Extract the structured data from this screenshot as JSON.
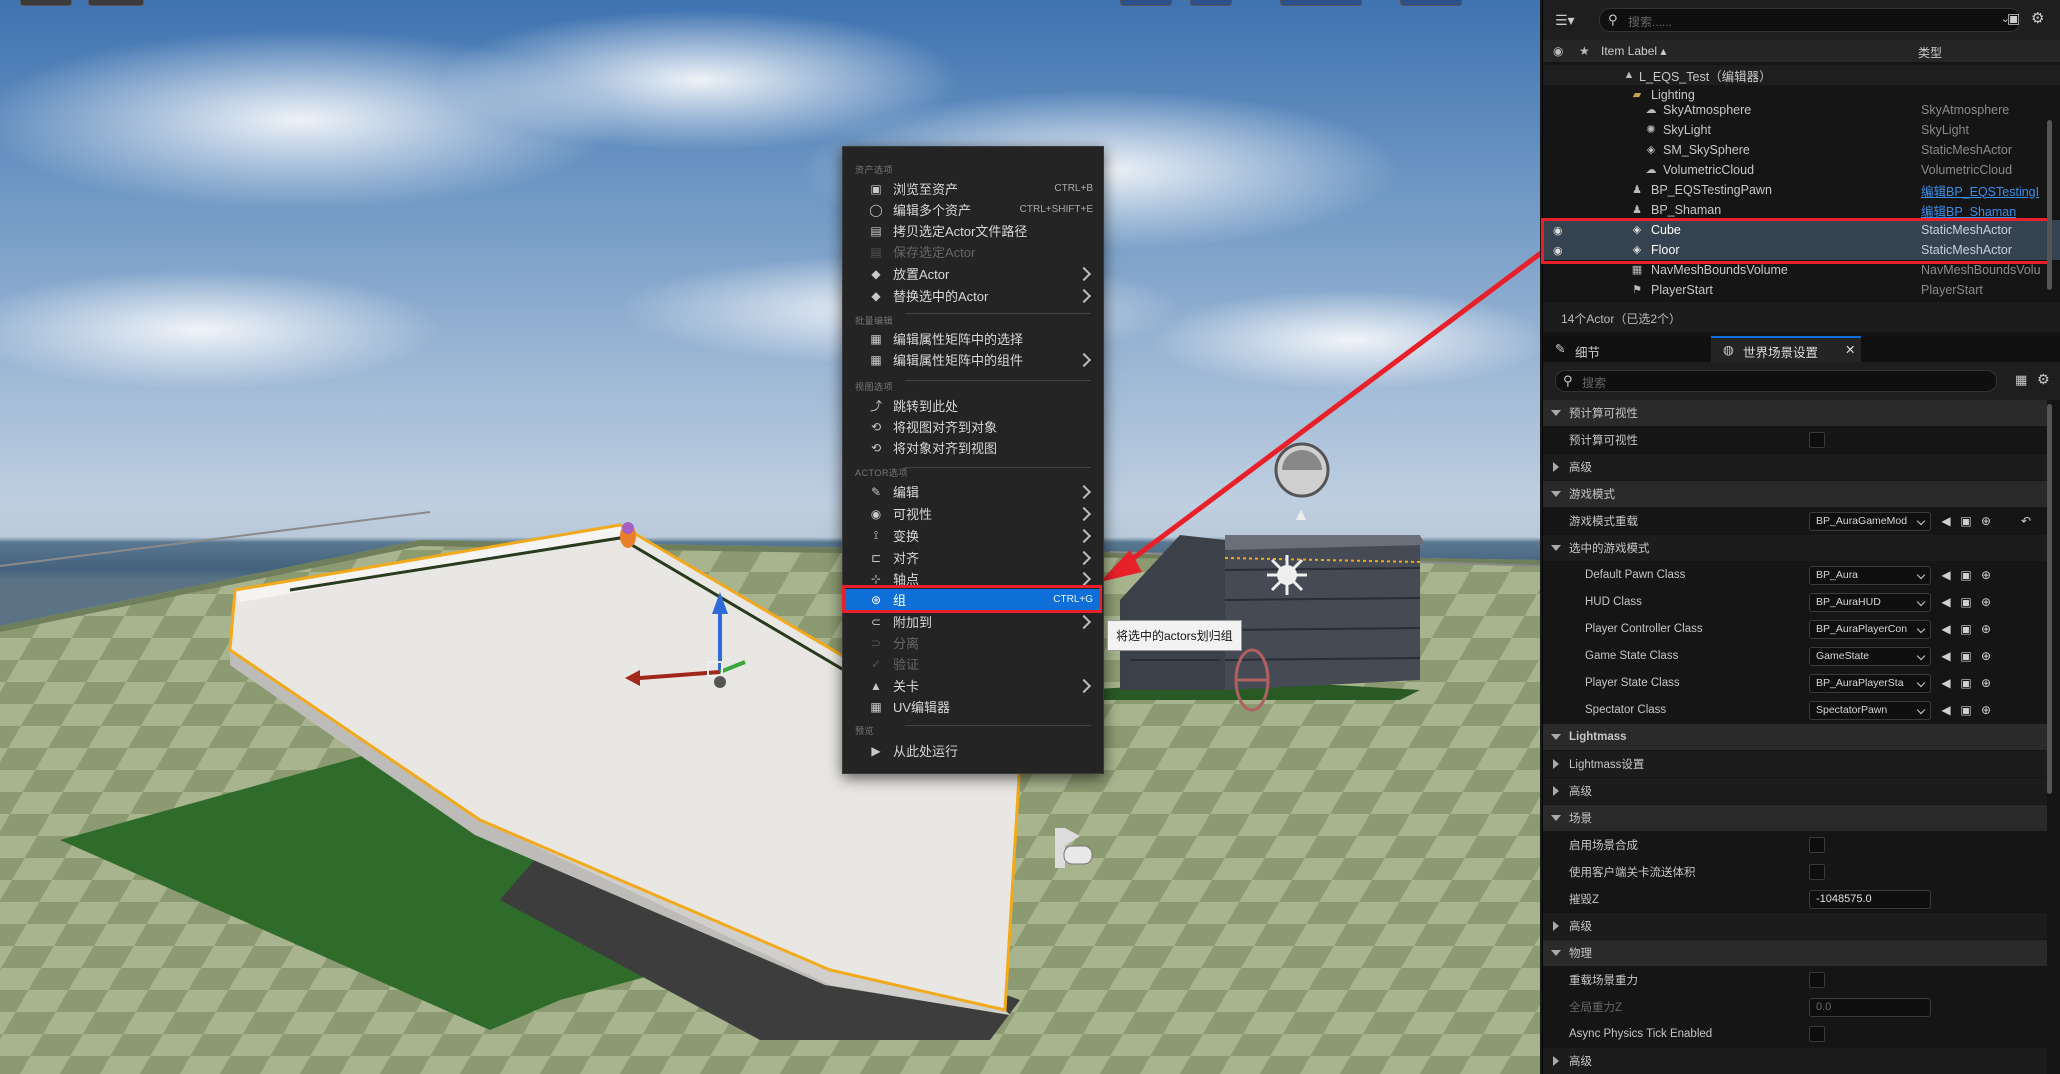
{
  "context_menu": {
    "sections": {
      "asset": "资产选项",
      "properties": "批量编辑",
      "view": "视图选项",
      "actor": "ACTOR选项",
      "preview": "预览"
    },
    "items": [
      {
        "label": "浏览至资产",
        "shortcut": "CTRL+B",
        "icon": "folder-browse-icon"
      },
      {
        "label": "编辑多个资产",
        "shortcut": "CTRL+SHIFT+E",
        "icon": "circle-icon"
      },
      {
        "label": "拷贝选定Actor文件路径",
        "shortcut": "",
        "icon": "copy-path-icon"
      },
      {
        "label": "保存选定Actor",
        "shortcut": "",
        "icon": "save-icon"
      },
      {
        "label": "放置Actor",
        "shortcut": "",
        "icon": "place-actor-icon"
      },
      {
        "label": "替换选中的Actor",
        "shortcut": "",
        "icon": "replace-actor-icon"
      },
      {
        "label": "编辑属性矩阵中的选择",
        "shortcut": "",
        "icon": "grid-icon"
      },
      {
        "label": "编辑属性矩阵中的组件",
        "shortcut": "",
        "icon": "grid-icon"
      },
      {
        "label": "跳转到此处",
        "shortcut": "",
        "icon": "snap-here-icon"
      },
      {
        "label": "将视图对齐到对象",
        "shortcut": "",
        "icon": "snap-view-icon"
      },
      {
        "label": "将对象对齐到视图",
        "shortcut": "",
        "icon": "snap-object-icon"
      },
      {
        "label": "编辑",
        "shortcut": "",
        "icon": "edit-icon"
      },
      {
        "label": "可视性",
        "shortcut": "",
        "icon": "eye-icon"
      },
      {
        "label": "变换",
        "shortcut": "",
        "icon": "transform-icon"
      },
      {
        "label": "对齐",
        "shortcut": "",
        "icon": "align-icon"
      },
      {
        "label": "轴点",
        "shortcut": "",
        "icon": "pivot-icon"
      },
      {
        "label": "组",
        "shortcut": "CTRL+G",
        "icon": "group-icon"
      },
      {
        "label": "附加到",
        "shortcut": "",
        "icon": "attach-icon"
      },
      {
        "label": "分离",
        "shortcut": "",
        "icon": "detach-icon"
      },
      {
        "label": "验证",
        "shortcut": "",
        "icon": "validate-icon"
      },
      {
        "label": "关卡",
        "shortcut": "",
        "icon": "level-icon"
      },
      {
        "label": "UV编辑器",
        "shortcut": "",
        "icon": "uv-editor-icon"
      },
      {
        "label": "从此处运行",
        "shortcut": "",
        "icon": "play-icon"
      }
    ],
    "tooltip": "将选中的actors划归组"
  },
  "outliner": {
    "search_placeholder": "搜索......",
    "col_label": "Item Label ▴",
    "col_type": "类型",
    "rows": [
      {
        "name": "L_EQS_Test（编辑器）",
        "type": "",
        "icon": "level-icon"
      },
      {
        "name": "Lighting",
        "type": "",
        "icon": "folder-icon"
      },
      {
        "name": "SkyAtmosphere",
        "type": "SkyAtmosphere",
        "icon": "sky-atmosphere-icon"
      },
      {
        "name": "SkyLight",
        "type": "SkyLight",
        "icon": "skylight-icon"
      },
      {
        "name": "SM_SkySphere",
        "type": "StaticMeshActor",
        "icon": "mesh-icon"
      },
      {
        "name": "VolumetricCloud",
        "type": "VolumetricCloud",
        "icon": "cloud-icon"
      },
      {
        "name": "BP_EQSTestingPawn",
        "type": "编辑BP_EQSTestingI",
        "icon": "pawn-icon"
      },
      {
        "name": "BP_Shaman",
        "type": "编辑BP_Shaman",
        "icon": "pawn-icon"
      },
      {
        "name": "Cube",
        "type": "StaticMeshActor",
        "icon": "mesh-icon"
      },
      {
        "name": "Floor",
        "type": "StaticMeshActor",
        "icon": "mesh-icon"
      },
      {
        "name": "NavMeshBoundsVolume",
        "type": "NavMeshBoundsVolu",
        "icon": "volume-icon"
      },
      {
        "name": "PlayerStart",
        "type": "PlayerStart",
        "icon": "player-start-icon"
      }
    ],
    "count": "14个Actor（已选2个）"
  },
  "details": {
    "tab_details": "细节",
    "tab_world": "世界场景设置",
    "search_placeholder": "搜索",
    "rows": [
      {
        "label": "预计算可视性",
        "kind": "cat"
      },
      {
        "label": "预计算可视性",
        "kind": "check"
      },
      {
        "label": "高级",
        "kind": "collapsed"
      },
      {
        "label": "游戏模式",
        "kind": "cat"
      },
      {
        "label": "游戏模式重载",
        "kind": "dropdown",
        "value": "BP_AuraGameMod"
      },
      {
        "label": "选中的游戏模式",
        "kind": "subcat"
      },
      {
        "label": "Default Pawn Class",
        "kind": "dropdown",
        "value": "BP_Aura"
      },
      {
        "label": "HUD Class",
        "kind": "dropdown",
        "value": "BP_AuraHUD"
      },
      {
        "label": "Player Controller Class",
        "kind": "dropdown",
        "value": "BP_AuraPlayerCon"
      },
      {
        "label": "Game State Class",
        "kind": "dropdown",
        "value": "GameState"
      },
      {
        "label": "Player State Class",
        "kind": "dropdown",
        "value": "BP_AuraPlayerSta"
      },
      {
        "label": "Spectator Class",
        "kind": "dropdown",
        "value": "SpectatorPawn"
      },
      {
        "label": "Lightmass",
        "kind": "cat"
      },
      {
        "label": "Lightmass设置",
        "kind": "collapsed"
      },
      {
        "label": "高级",
        "kind": "collapsed"
      },
      {
        "label": "场景",
        "kind": "cat"
      },
      {
        "label": "启用场景合成",
        "kind": "check"
      },
      {
        "label": "使用客户端关卡流送体积",
        "kind": "check"
      },
      {
        "label": "摧毁Z",
        "kind": "text",
        "value": "-1048575.0"
      },
      {
        "label": "高级",
        "kind": "collapsed"
      },
      {
        "label": "物理",
        "kind": "cat"
      },
      {
        "label": "重载场景重力",
        "kind": "check"
      },
      {
        "label": "全局重力Z",
        "kind": "text_dim",
        "value": "0.0"
      },
      {
        "label": "Async Physics Tick Enabled",
        "kind": "check"
      },
      {
        "label": "高级",
        "kind": "collapsed"
      }
    ]
  },
  "colors": {
    "highlight": "#0f6fd8",
    "annotation_red": "#e8202a",
    "selection_row": "#35424f"
  }
}
